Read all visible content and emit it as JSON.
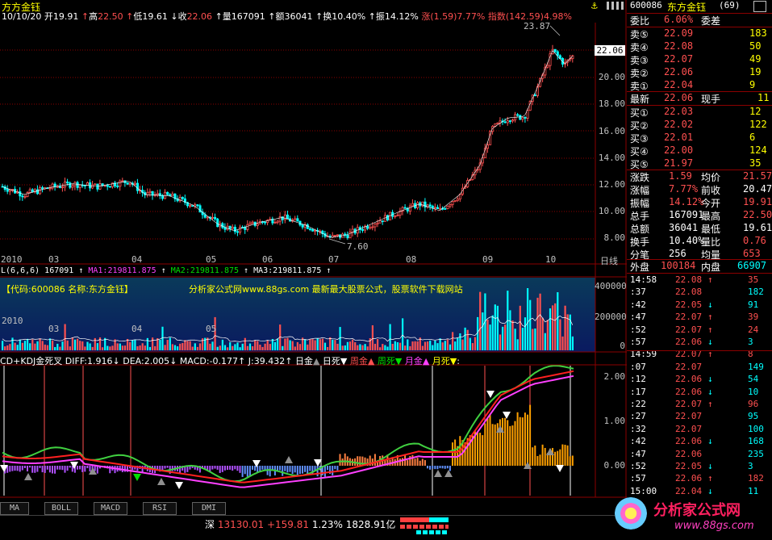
{
  "header": {
    "title": "方方金钰",
    "date": "10/10/20",
    "open_label": "开",
    "open": "19.91",
    "high_label": "高",
    "high": "22.50",
    "low_label": "低",
    "low": "19.61",
    "close_label": "收",
    "close": "22.06",
    "vol_label": "量",
    "vol": "167091",
    "amount_label": "额",
    "amount": "36041",
    "turnover_label": "换",
    "turnover": "10.40%",
    "amplitude_label": "振",
    "amplitude": "14.12%",
    "change_label": "涨",
    "change": "(1.59)7.77%",
    "index_label": "指数",
    "index": "(142.59)4.98%"
  },
  "price_chart": {
    "y_ticks": [
      "22.06",
      "20.00",
      "18.00",
      "16.00",
      "14.00",
      "12.00",
      "10.00",
      "8.00"
    ],
    "high_label": "23.87",
    "low_label": "7.60",
    "x_labels": [
      "2010",
      "03",
      "04",
      "05",
      "06",
      "07",
      "08",
      "09",
      "10"
    ],
    "period_label": "日线",
    "colors": {
      "up": "#ff5050",
      "down": "#00ffff",
      "grid": "#8b0000",
      "ma": "#ffffff"
    }
  },
  "volume_chart": {
    "label_line": "L(6,6,6) 167091 ↑ MA1:219811.875 ↑ MA2:219811.875 ↑ MA3:219811.875 ↑",
    "l_part": "L(6,6,6) 167091",
    "ma1": "MA1:219811.875",
    "ma2": "MA2:219811.875",
    "ma3": "MA3:219811.875",
    "code_text": "【代码:600086 名称:东方金钰】",
    "promo_text": "分析家公式网www.88gs.com 最新最大股票公式，股票软件下载网站",
    "y_ticks": [
      "400000",
      "200000",
      "0"
    ]
  },
  "macd_chart": {
    "title": "CD+KDJ金死叉",
    "diff": "DIFF:1.916",
    "dea": "DEA:2.005",
    "macd": "MACD:-0.177",
    "j": "J:39.432",
    "legend": [
      "日金",
      "日死",
      "周金",
      "周死",
      "月金",
      "月死"
    ],
    "y_ticks": [
      "2.00",
      "1.00",
      "0.00"
    ]
  },
  "tabs": [
    "MA",
    "BOLL",
    "MACD",
    "RSI",
    "DMI"
  ],
  "status_bar": {
    "market": "深",
    "index": "13130.01",
    "change": "+159.81",
    "pct": "1.23%",
    "amount": "1828.91亿"
  },
  "quote_panel": {
    "code": "600086",
    "name": "东方金钰",
    "count": "(69)",
    "webi_label": "委比",
    "webi": "6.06%",
    "wecha_label": "委差",
    "wecha": "",
    "asks": [
      {
        "label": "卖⑤",
        "price": "22.09",
        "vol": "183"
      },
      {
        "label": "卖④",
        "price": "22.08",
        "vol": "50"
      },
      {
        "label": "卖③",
        "price": "22.07",
        "vol": "49"
      },
      {
        "label": "卖②",
        "price": "22.06",
        "vol": "19"
      },
      {
        "label": "卖①",
        "price": "22.04",
        "vol": "9"
      }
    ],
    "last_label": "最新",
    "last": "22.06",
    "cur_label": "现手",
    "cur": "11",
    "bids": [
      {
        "label": "买①",
        "price": "22.03",
        "vol": "12"
      },
      {
        "label": "买②",
        "price": "22.02",
        "vol": "122"
      },
      {
        "label": "买③",
        "price": "22.01",
        "vol": "6"
      },
      {
        "label": "买④",
        "price": "22.00",
        "vol": "124"
      },
      {
        "label": "买⑤",
        "price": "21.97",
        "vol": "35"
      }
    ],
    "stats": [
      {
        "l1": "涨跌",
        "v1": "1.59",
        "l2": "均价",
        "v2": "21.57"
      },
      {
        "l1": "涨幅",
        "v1": "7.77%",
        "l2": "前收",
        "v2": "20.47"
      },
      {
        "l1": "振幅",
        "v1": "14.12%",
        "l2": "今开",
        "v2": "19.91"
      },
      {
        "l1": "总手",
        "v1": "167091",
        "l2": "最高",
        "v2": "22.50"
      },
      {
        "l1": "总额",
        "v1": "36041",
        "l2": "最低",
        "v2": "19.61"
      },
      {
        "l1": "换手",
        "v1": "10.40%",
        "l2": "量比",
        "v2": "0.76"
      },
      {
        "l1": "分笔",
        "v1": "256",
        "l2": "均量",
        "v2": "653"
      }
    ],
    "outer_label": "外盘",
    "outer": "100184",
    "inner_label": "内盘",
    "inner": "66907"
  },
  "ticks": [
    {
      "t": "14:58",
      "p": "22.08",
      "d": "↑",
      "v": "35"
    },
    {
      "t": ":37",
      "p": "22.08",
      "d": "",
      "v": "182"
    },
    {
      "t": ":42",
      "p": "22.05",
      "d": "↓",
      "v": "91"
    },
    {
      "t": ":47",
      "p": "22.07",
      "d": "↑",
      "v": "39"
    },
    {
      "t": ":52",
      "p": "22.07",
      "d": "↑",
      "v": "24"
    },
    {
      "t": ":57",
      "p": "22.06",
      "d": "↓",
      "v": "3"
    },
    {
      "t": "14:59",
      "p": "22.07",
      "d": "↑",
      "v": "8"
    },
    {
      "t": ":07",
      "p": "22.07",
      "d": "",
      "v": "149"
    },
    {
      "t": ":12",
      "p": "22.06",
      "d": "↓",
      "v": "54"
    },
    {
      "t": ":17",
      "p": "22.06",
      "d": "↓",
      "v": "10"
    },
    {
      "t": ":22",
      "p": "22.07",
      "d": "↑",
      "v": "96"
    },
    {
      "t": ":27",
      "p": "22.07",
      "d": "",
      "v": "95"
    },
    {
      "t": ":32",
      "p": "22.07",
      "d": "",
      "v": "100"
    },
    {
      "t": ":42",
      "p": "22.06",
      "d": "↓",
      "v": "168"
    },
    {
      "t": ":47",
      "p": "22.06",
      "d": "",
      "v": "235"
    },
    {
      "t": ":52",
      "p": "22.05",
      "d": "↓",
      "v": "3"
    },
    {
      "t": ":57",
      "p": "22.06",
      "d": "↑",
      "v": "182"
    },
    {
      "t": "15:00",
      "p": "22.04",
      "d": "↓",
      "v": "11"
    }
  ],
  "logo": {
    "text": "分析家公式网",
    "url": "www.88gs.com"
  }
}
